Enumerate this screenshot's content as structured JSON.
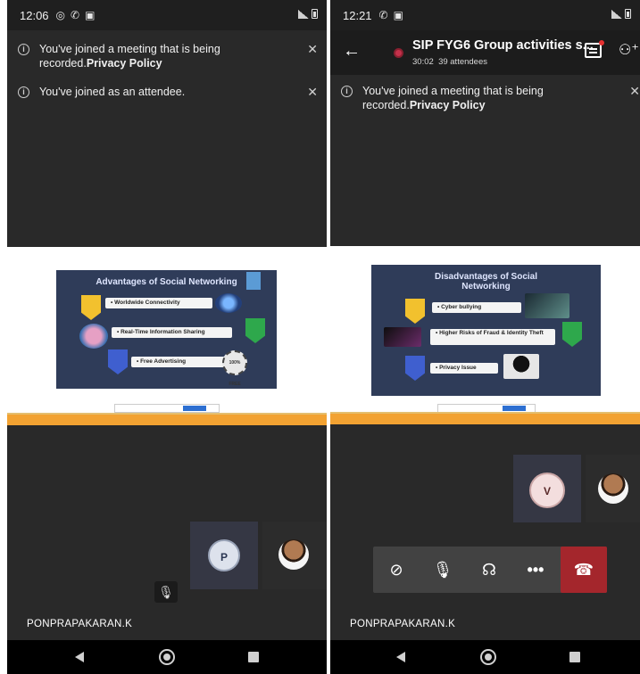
{
  "left": {
    "status_time": "12:06",
    "notices": [
      {
        "text": "You've joined a meeting that is being recorded.",
        "link": "Privacy Policy",
        "close": "✕"
      },
      {
        "text": "You've joined as an attendee.",
        "link": "",
        "close": "✕"
      }
    ],
    "slide": {
      "title": "Advantages of Social Networking",
      "bullets": [
        "• Worldwide Connectivity",
        "• Real-Time Information Sharing",
        "• Free Advertising"
      ],
      "badge": "100% FREE"
    },
    "participant_initial": "P",
    "name_label": "PONPRAPAKARAN.K"
  },
  "right": {
    "status_time": "12:21",
    "meeting_title": "SIP FYG6 Group activities s...",
    "duration": "30:02",
    "attendees": "39 attendees",
    "notices": [
      {
        "text": "You've joined a meeting that is being recorded.",
        "link": "Privacy Policy",
        "close": "✕"
      }
    ],
    "slide": {
      "title": "Disadvantages of Social Networking",
      "bullets": [
        "• Cyber bullying",
        "• Higher Risks of Fraud & Identity Theft",
        "• Privacy Issue"
      ]
    },
    "participant_initial": "V",
    "name_label": "PONPRAPAKARAN.K",
    "controls": [
      "camera-off",
      "mic-off",
      "audio",
      "more",
      "hang-up"
    ]
  },
  "colors": {
    "meeting_bg": "#292929",
    "record_red": "#c4314b",
    "hangup_red": "#a4262c",
    "orange_strip": "#f2a232",
    "slide_bg": "#2f3c59"
  }
}
